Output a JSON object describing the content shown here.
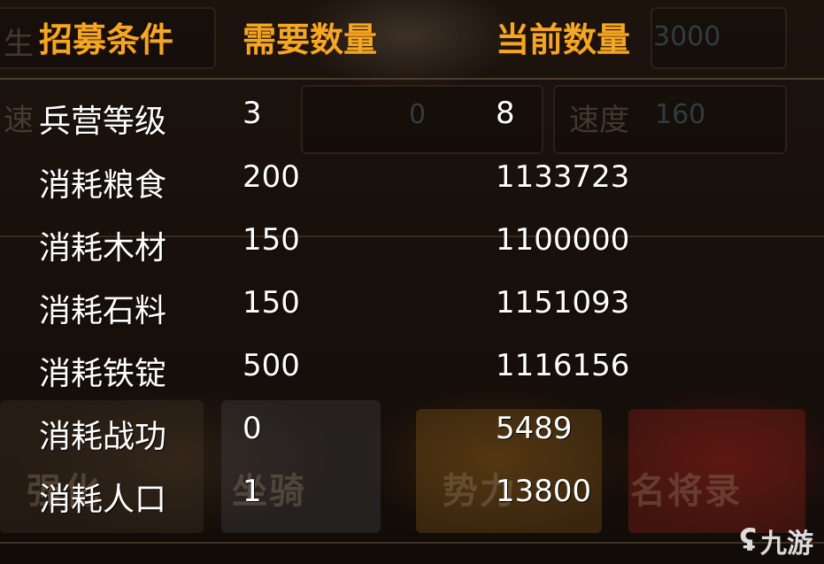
{
  "background": {
    "faded_labels": {
      "left_top": "生",
      "left_mid": "速",
      "right_mid": "速度"
    },
    "faded_numbers": {
      "top_right": "3000",
      "mid_center": "0",
      "right_mid": "160"
    },
    "bottom_tabs": [
      "强化",
      "坐骑",
      "势力",
      "名将录"
    ]
  },
  "table": {
    "headers": {
      "condition": "招募条件",
      "required": "需要数量",
      "current": "当前数量"
    },
    "rows": [
      {
        "label": "兵营等级",
        "required": "3",
        "current": "8"
      },
      {
        "label": "消耗粮食",
        "required": "200",
        "current": "1133723"
      },
      {
        "label": "消耗木材",
        "required": "150",
        "current": "1100000"
      },
      {
        "label": "消耗石料",
        "required": "150",
        "current": "1151093"
      },
      {
        "label": "消耗铁锭",
        "required": "500",
        "current": "1116156"
      },
      {
        "label": "消耗战功",
        "required": "0",
        "current": "5489"
      },
      {
        "label": "消耗人口",
        "required": "1",
        "current": "13800"
      }
    ]
  },
  "watermark": {
    "logo": "九游"
  },
  "colors": {
    "header": "#f5a623",
    "cell_text": "#ffffff",
    "background": "#160f0a"
  }
}
